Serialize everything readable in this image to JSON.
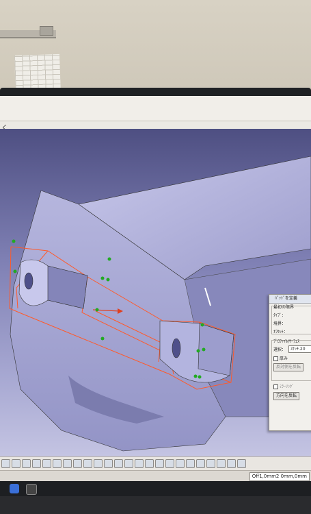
{
  "window": {
    "title_glyph": "く"
  },
  "dialog": {
    "title": "ﾊﾟｯﾄﾞを定義",
    "group_first_limit": "最初の限界",
    "type_label": "ﾀｲﾌﾟ：",
    "limit_label": "境界：",
    "offset_label": "ｵﾌｾｯﾄ：",
    "group_profile": "ﾌﾟﾛﾌｧｲﾙ/ｻｰﾌｪｽ",
    "selection_label": "選択：",
    "selection_value": "ｽｹｯﾁ.20",
    "thickness_label": "厚み",
    "reverse_side_button": "反対側を反転",
    "reverse_direction_button": "方向を反転",
    "mirror_label": "ﾐﾗｰﾘﾝｸﾞ"
  },
  "statusbar": {
    "field_value": "Off1,0mm2 0mm,0mm"
  },
  "colors": {
    "viewport_top": "#4e4f82",
    "viewport_bottom": "#c5c5e3",
    "sketch_edge": "#ff5a2a",
    "bezel": "#1f2124"
  },
  "toolbar": {
    "icons": [
      "select-icon",
      "pan-icon",
      "rotate-icon",
      "zoom-in-icon",
      "zoom-out-icon",
      "fit-all-icon",
      "normal-view-icon",
      "iso-view-icon",
      "shading-icon",
      "hide-show-icon",
      "swap-icon",
      "axis-icon",
      "measure-icon",
      "analysis-icon",
      "material-icon",
      "render-icon",
      "camera-icon",
      "plane-icon",
      "sketch-icon",
      "constraint-icon",
      "lock-icon",
      "dimension-icon",
      "snap-icon",
      "grid-icon"
    ]
  }
}
